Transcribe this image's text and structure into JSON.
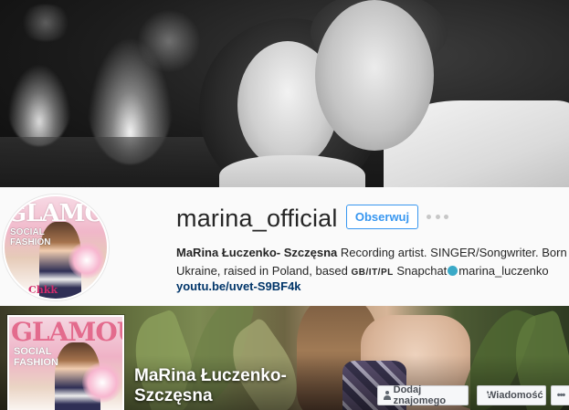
{
  "instagram": {
    "username": "marina_official",
    "follow_label": "Obserwuj",
    "bio": {
      "name": "MaRina Łuczenko- Szczęsna",
      "text1": " Recording artist. SINGER/Songwriter. Born Ukraine, raised in Poland, based ",
      "countries": "GB/IT/PL",
      "snap_label": " Snapchat",
      "snap_handle": "marina_luczenko"
    },
    "link": "youtu.be/uvet-S9BF4k",
    "avatar_cover": {
      "title": "GLAMOUR",
      "subtitle": "SOCIAL\nFASHION",
      "tag": "Chkk"
    }
  },
  "facebook": {
    "name_line1": "MaRina Łuczenko-",
    "name_line2": "Szczęsna",
    "add_friend_label": "Dodaj znajomego",
    "message_label": "Wiadomość",
    "more_label": "•••",
    "avatar_cover": {
      "title": "GLAMOUR",
      "subtitle": "SOCIAL\nFASHION"
    }
  },
  "colors": {
    "ig_blue": "#3897f0",
    "ig_link": "#003569",
    "fb_button_bg": "#f6f7f9",
    "fb_button_text": "#4b4f56"
  },
  "icons": [
    "more-dots-icon",
    "add-friend-icon",
    "message-icon",
    "snapchat-icon"
  ]
}
